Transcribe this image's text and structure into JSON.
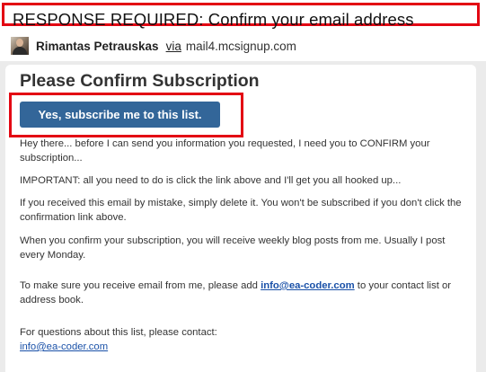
{
  "subject": "RESPONSE REQUIRED: Confirm your email address",
  "sender": {
    "name": "Rimantas Petrauskas",
    "via": "via",
    "domain": "mail4.mcsignup.com"
  },
  "email": {
    "heading": "Please Confirm Subscription",
    "button_label": "Yes, subscribe me to this list.",
    "paragraphs": {
      "greeting": "Hey there... before I can send you information you requested, I need you to CONFIRM your subscription...",
      "important": "IMPORTANT: all you need to do is click the link above and I'll get you all hooked up...",
      "mistake": "If you received this email by mistake, simply delete it. You won't be subscribed if you don't click the confirmation link above.",
      "weekly": "When you confirm your subscription, you will receive weekly blog posts from me. Usually I post every Monday.",
      "contact_before": "To make sure you receive email from me, please add ",
      "contact_email": "info@ea-coder.com",
      "contact_after": " to your contact list or address book.",
      "questions": "For questions about this list, please contact:",
      "questions_email": "info@ea-coder.com"
    }
  },
  "colors": {
    "highlight_border": "#e30613",
    "button_bg": "#336699",
    "link": "#1a51a8",
    "page_bg": "#ebebeb"
  }
}
